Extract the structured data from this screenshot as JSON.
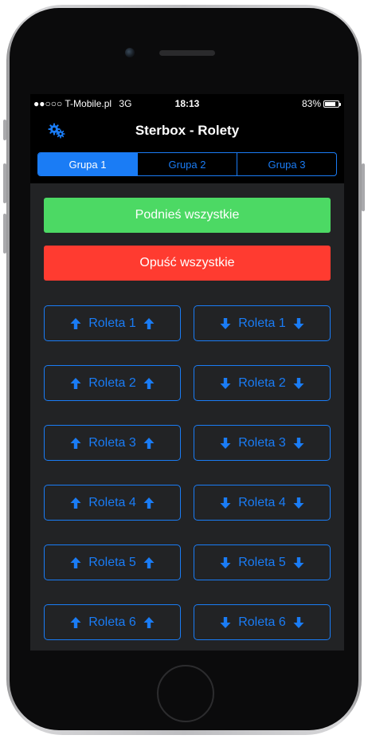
{
  "status_bar": {
    "carrier": "●●○○○ T-Mobile.pl",
    "network": "3G",
    "time": "18:13",
    "battery": "83%",
    "battery_level": 0.83
  },
  "nav": {
    "title": "Sterbox - Rolety",
    "settings_icon": "gears-icon"
  },
  "tabs": [
    {
      "label": "Grupa 1",
      "active": true
    },
    {
      "label": "Grupa 2",
      "active": false
    },
    {
      "label": "Grupa 3",
      "active": false
    }
  ],
  "actions": {
    "raise_all": "Podnieś wszystkie",
    "lower_all": "Opuść wszystkie"
  },
  "rollers": [
    {
      "up": "Roleta 1",
      "down": "Roleta 1"
    },
    {
      "up": "Roleta 2",
      "down": "Roleta 2"
    },
    {
      "up": "Roleta 3",
      "down": "Roleta 3"
    },
    {
      "up": "Roleta 4",
      "down": "Roleta 4"
    },
    {
      "up": "Roleta 5",
      "down": "Roleta 5"
    },
    {
      "up": "Roleta 6",
      "down": "Roleta 6"
    }
  ],
  "colors": {
    "accent": "#1a7cf5",
    "raise": "#4cd964",
    "lower": "#ff3b30",
    "background": "#222325"
  }
}
